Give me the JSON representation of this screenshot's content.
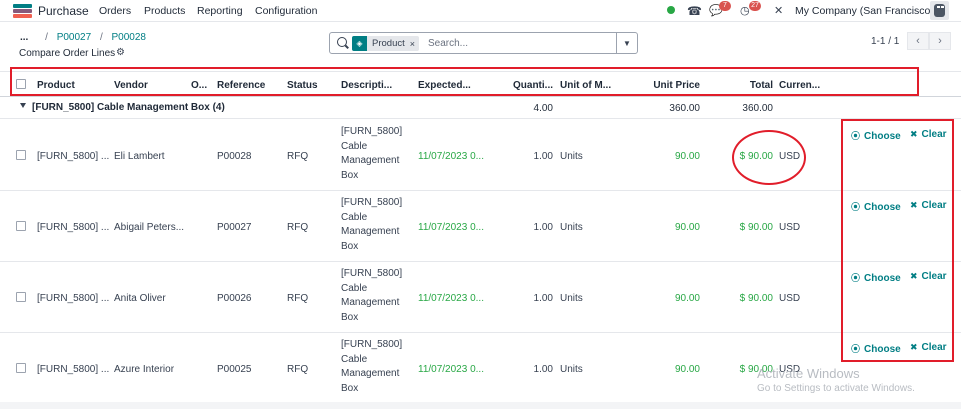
{
  "nav": {
    "app_title": "Purchase",
    "menu": [
      "Orders",
      "Products",
      "Reporting",
      "Configuration"
    ],
    "company": "My Company (San Francisco)",
    "badges": {
      "chat": "7",
      "activity": "27"
    },
    "colors": {
      "online": "#28a745",
      "badge": "#d9534f"
    }
  },
  "breadcrumb": {
    "dots": "...",
    "sep1": "/",
    "crumb1": "P00027",
    "sep2": "/",
    "crumb2": "P00028"
  },
  "page_title": "Compare Order Lines",
  "search": {
    "facet_label": "Product",
    "facet_close": "×",
    "placeholder": "Search...",
    "facet_icon": "layers-icon"
  },
  "pager": {
    "text": "1-1 / 1",
    "prev": "‹",
    "next": "›"
  },
  "table": {
    "columns": {
      "product": "Product",
      "vendor": "Vendor",
      "o": "O...",
      "reference": "Reference",
      "status": "Status",
      "description": "Descripti...",
      "expected": "Expected...",
      "quantity": "Quanti...",
      "uom": "Unit of M...",
      "unit_price": "Unit Price",
      "total": "Total",
      "currency": "Curren..."
    },
    "group": {
      "label": "[FURN_5800] Cable Management Box (4)",
      "quantity": "4.00",
      "unit_price": "360.00",
      "total": "360.00"
    },
    "rows": [
      {
        "product": "[FURN_5800] ...",
        "vendor": "Eli Lambert",
        "reference": "P00028",
        "status": "RFQ",
        "description": "[FURN_5800] Cable Management Box",
        "expected": "11/07/2023 0...",
        "quantity": "1.00",
        "uom": "Units",
        "unit_price": "90.00",
        "total": "$ 90.00",
        "currency": "USD",
        "choose": "Choose",
        "clear": "Clear"
      },
      {
        "product": "[FURN_5800] ...",
        "vendor": "Abigail Peters...",
        "reference": "P00027",
        "status": "RFQ",
        "description": "[FURN_5800] Cable Management Box",
        "expected": "11/07/2023 0...",
        "quantity": "1.00",
        "uom": "Units",
        "unit_price": "90.00",
        "total": "$ 90.00",
        "currency": "USD",
        "choose": "Choose",
        "clear": "Clear"
      },
      {
        "product": "[FURN_5800] ...",
        "vendor": "Anita Oliver",
        "reference": "P00026",
        "status": "RFQ",
        "description": "[FURN_5800] Cable Management Box",
        "expected": "11/07/2023 0...",
        "quantity": "1.00",
        "uom": "Units",
        "unit_price": "90.00",
        "total": "$ 90.00",
        "currency": "USD",
        "choose": "Choose",
        "clear": "Clear"
      },
      {
        "product": "[FURN_5800] ...",
        "vendor": "Azure Interior",
        "reference": "P00025",
        "status": "RFQ",
        "description": "[FURN_5800] Cable Management Box",
        "expected": "11/07/2023 0...",
        "quantity": "1.00",
        "uom": "Units",
        "unit_price": "90.00",
        "total": "$ 90.00",
        "currency": "USD",
        "choose": "Choose",
        "clear": "Clear"
      }
    ]
  },
  "watermark": {
    "line1": "Activate Windows",
    "line2": "Go to Settings to activate Windows."
  },
  "colors": {
    "accent": "#017e84",
    "green": "#28a745",
    "highlight": "#e11d2a"
  }
}
